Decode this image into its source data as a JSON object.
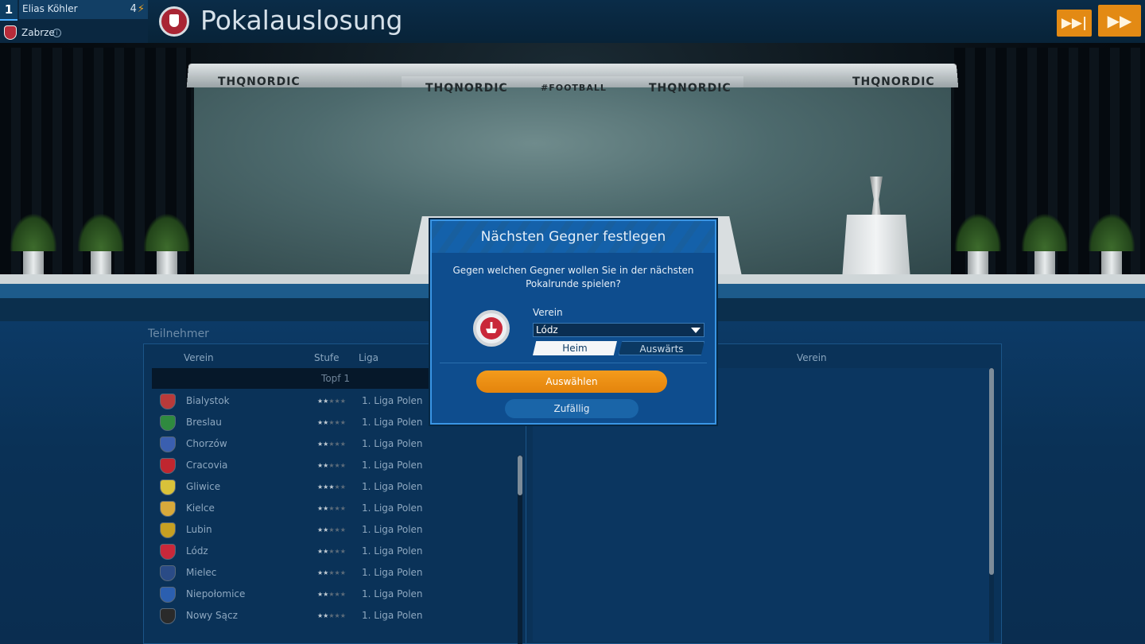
{
  "manager": {
    "rank": "1",
    "name": "Elias Köhler",
    "level": "4"
  },
  "club": {
    "name": "Zabrze"
  },
  "page": {
    "title": "Pokalauslosung"
  },
  "stage_logos": [
    "THQNORDIC",
    "THQNORDIC",
    "#FOOTBALL",
    "THQNORDIC",
    "THQNORDIC"
  ],
  "participants": {
    "section_label": "Teilnehmer",
    "columns": {
      "club": "Verein",
      "level": "Stufe",
      "league": "Liga"
    },
    "pot_label": "Topf 1",
    "teams": [
      {
        "name": "Bialystok",
        "stars": 2,
        "league": "1. Liga Polen",
        "crest_color": "#b93a3a"
      },
      {
        "name": "Breslau",
        "stars": 2,
        "league": "1. Liga Polen",
        "crest_color": "#2f8a3f"
      },
      {
        "name": "Chorzów",
        "stars": 2,
        "league": "1. Liga Polen",
        "crest_color": "#3a5fb0"
      },
      {
        "name": "Cracovia",
        "stars": 2,
        "league": "1. Liga Polen",
        "crest_color": "#c0262f"
      },
      {
        "name": "Gliwice",
        "stars": 3,
        "league": "1. Liga Polen",
        "crest_color": "#d9c23a"
      },
      {
        "name": "Kielce",
        "stars": 2,
        "league": "1. Liga Polen",
        "crest_color": "#d8a93b"
      },
      {
        "name": "Lubin",
        "stars": 2,
        "league": "1. Liga Polen",
        "crest_color": "#c7a022"
      },
      {
        "name": "Lódz",
        "stars": 2,
        "league": "1. Liga Polen",
        "crest_color": "#c9283a"
      },
      {
        "name": "Mielec",
        "stars": 2,
        "league": "1. Liga Polen",
        "crest_color": "#2a4b86"
      },
      {
        "name": "Niepołomice",
        "stars": 2,
        "league": "1. Liga Polen",
        "crest_color": "#2b5fb0"
      },
      {
        "name": "Nowy Sącz",
        "stars": 2,
        "league": "1. Liga Polen",
        "crest_color": "#2a2a2a"
      }
    ]
  },
  "opponents": {
    "columns": {
      "club": "Verein"
    }
  },
  "dialog": {
    "title": "Nächsten Gegner festlegen",
    "question": "Gegen welchen Gegner wollen Sie in der nächsten Pokalrunde spielen?",
    "field_label": "Verein",
    "selected_club": "Lódz",
    "toggle_home": "Heim",
    "toggle_away": "Auswärts",
    "select_button": "Auswählen",
    "random_button": "Zufällig"
  },
  "colors": {
    "accent_orange": "#e38a14",
    "panel_blue": "#0e4d8e",
    "crest_red": "#c9283a"
  }
}
